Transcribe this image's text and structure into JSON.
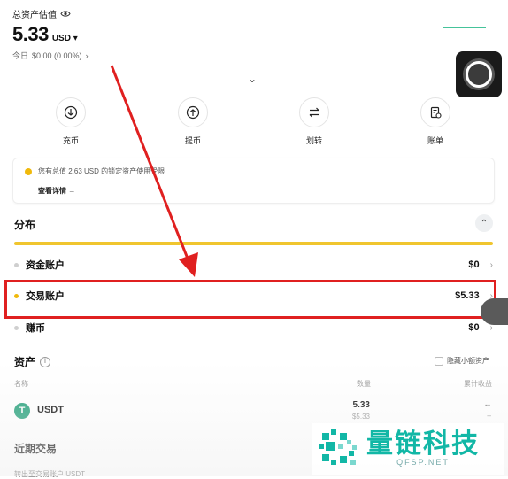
{
  "header": {
    "title": "总资产估值",
    "balance": "5.33",
    "currency": "USD",
    "today_label": "今日",
    "today_change": "$0.00 (0.00%)"
  },
  "actions": [
    {
      "label": "充币",
      "icon": "deposit-icon"
    },
    {
      "label": "提币",
      "icon": "withdraw-icon"
    },
    {
      "label": "划转",
      "icon": "transfer-icon"
    },
    {
      "label": "账单",
      "icon": "bill-icon"
    }
  ],
  "notice": {
    "text": "您有总值 2.63 USD 的锁定资产使用受限",
    "link": "查看详情 →"
  },
  "distribution": {
    "title": "分布",
    "accounts": [
      {
        "name": "资金账户",
        "value": "$0"
      },
      {
        "name": "交易账户",
        "value": "$5.33"
      },
      {
        "name": "赚币",
        "value": "$0"
      }
    ]
  },
  "assets": {
    "title": "资产",
    "hide_small": "隐藏小额资产",
    "columns": {
      "name": "名称",
      "qty": "数量",
      "earn": "累计收益"
    },
    "rows": [
      {
        "symbol": "USDT",
        "icon_glyph": "T",
        "qty": "5.33",
        "usd": "$5.33",
        "earn": "--",
        "earn_sub": "--"
      }
    ]
  },
  "recent": {
    "title": "近期交易",
    "first_item": "转出至交易账户 USDT"
  },
  "watermark": {
    "main": "量链科技",
    "sub": "QFSP.NET"
  },
  "colors": {
    "accent_yellow": "#f0b90b",
    "distribution_bar": "#f0c52e",
    "highlight_red": "#e02020",
    "usdt_green": "#26a17b",
    "watermark_teal": "#12b7a6"
  }
}
